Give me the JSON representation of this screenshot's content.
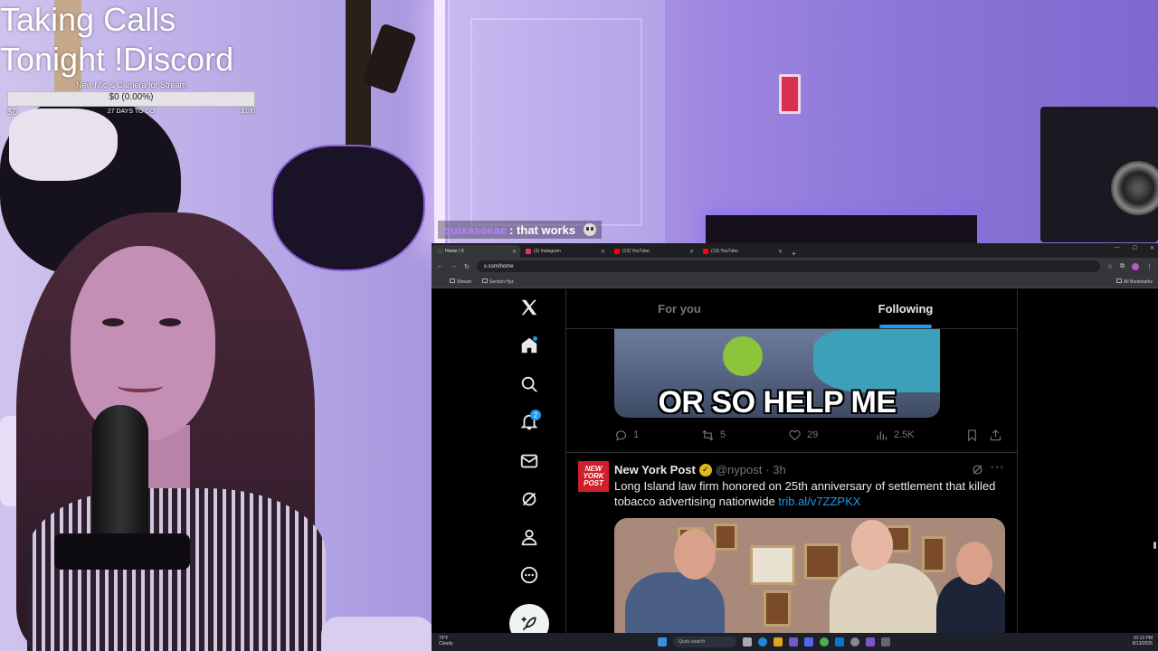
{
  "overlay": {
    "title_line1": "Taking Calls",
    "title_line2": "Tonight !Discord",
    "goal": {
      "name": "New Mic & Camera for Stream",
      "amount": "$0 (0.00%)",
      "progress_fraction": 0,
      "min": "$0",
      "days_left": "27 DAYS TO GO",
      "max": "$100"
    }
  },
  "chat": {
    "username": "quixaseeae",
    "message": ": that works"
  },
  "browser": {
    "tabs": [
      {
        "label": "Home / X",
        "color": "#000000"
      },
      {
        "label": "(3) Instagram",
        "color": "#e1306c"
      },
      {
        "label": "(13) YouTube",
        "color": "#ff0000"
      },
      {
        "label": "(13) YouTube",
        "color": "#ff0000"
      }
    ],
    "new_tab": "+",
    "url": "x.com/home",
    "bookmarks": [
      "Stream",
      "Section Hyz"
    ],
    "all_bookmarks": "All Bookmarks"
  },
  "x": {
    "feed_tabs": [
      "For you",
      "Following"
    ],
    "active_tab_index": 1,
    "notification_count": "2",
    "post1": {
      "gif_caption": "OR SO HELP ME",
      "replies": "1",
      "reposts": "5",
      "likes": "29",
      "views": "2.5K"
    },
    "post2": {
      "avatar_text": "NEW YORK POST",
      "name": "New York Post",
      "handle": "@nypost",
      "time": "· 3h",
      "text": "Long Island law firm honored on 25th anniversary of settlement that killed tobacco advertising nationwide",
      "link": "trib.al/v7ZZPKX"
    }
  },
  "taskbar": {
    "weather_temp": "79°F",
    "weather_desc": "Cloudy",
    "search_placeholder": "Quick search",
    "time": "10:13 PM",
    "date": "8/13/2025"
  },
  "colors": {
    "x_blue": "#1d9bf0",
    "twitch_purple": "#b183ff",
    "nypost_red": "#cf1f2b"
  }
}
